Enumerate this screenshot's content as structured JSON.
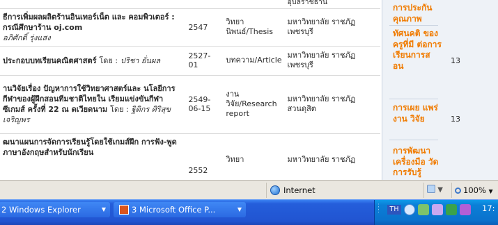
{
  "results": {
    "rows": [
      {
        "title": "",
        "by": "",
        "author": "",
        "year": "",
        "type": "",
        "university": "อุบลราชธานี"
      },
      {
        "title": "ธีการเพิ่มผลผลิตร้านอินเทอร์เน็ต และ คอมพิวเตอร์ : กรณีศึกษาร้าน oj.com",
        "by": "",
        "author": "อภิศักดิ์ รุ่งแสง",
        "year": "2547",
        "type": "วิทยา นิพนธ์/Thesis",
        "university": "มหาวิทยาลัย ราชภัฏเพชรบุรี"
      },
      {
        "title": "ประกอบบทเรียนคณิตศาสตร์",
        "by": "โดย :",
        "author": "ปริชา ยั่นผล",
        "year": "2527-01",
        "type": "บทความ/Article",
        "university": "มหาวิทยาลัย ราชภัฏเพชรบุรี"
      },
      {
        "title": "านวิจัยเรื่อง ปัญหาการใช้วิทยาศาสตร์และ นโลยีการกีฬาของผู้ฝึกสอนทีมชาติไทยใน เรียมแข่งขันกีฬาซีเกมส์ ครั้งที่ 22 ณ ดเวียดนาม",
        "by": "โดย :",
        "author": "ฐิติกร ศิริสุขเจริญพร",
        "year": "2549-06-15",
        "type": "งาน วิจัย/Research report",
        "university": "มหาวิทยาลัย ราชภัฏสวนดุสิต"
      },
      {
        "title": "ฒนาแผนการจัดการเรียนรู้โดยใช้เกมส์ฝึก การฟัง-พูดภาษาอังกฤษสำหรับนักเรียน",
        "by": "",
        "author": "",
        "year": "2552",
        "type": "วิทยา",
        "university": "มหาวิทยาลัย ราชภัฏ"
      }
    ]
  },
  "facet": {
    "items": [
      {
        "label": "การประกัน คุณภาพ",
        "count": ""
      },
      {
        "label": "ทัศนคติ ของครูที่มี ต่อการ เรียนการส อน",
        "count": "13"
      },
      {
        "label": "การเผย แพร่งาน วิจัย",
        "count": "13"
      },
      {
        "label": "การพัฒนา เครื่องมือ วัดการรับรู้",
        "count": ""
      }
    ]
  },
  "statusbar": {
    "zone_label": "Internet",
    "zoom_label": "100%",
    "zoom_caret": "▼",
    "protect_caret": "▼"
  },
  "taskbar": {
    "tasks": [
      {
        "label": "2 Windows Explorer",
        "caret": "▼"
      },
      {
        "label": "3 Microsoft Office P...",
        "caret": "▼"
      }
    ],
    "tray_lang": "TH",
    "clock": "17:"
  }
}
